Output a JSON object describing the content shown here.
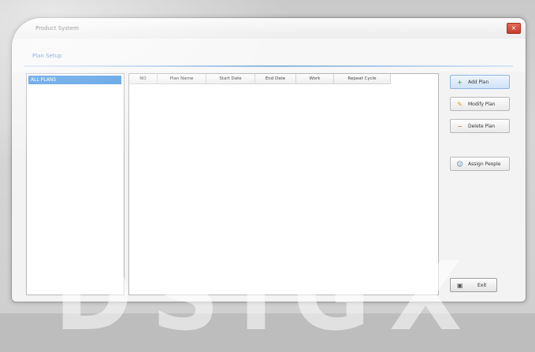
{
  "window": {
    "title": "Product System",
    "close_label": "×"
  },
  "tabs": [
    {
      "label": "Plan Setup"
    }
  ],
  "tree": {
    "selected_item": "ALL PLANS"
  },
  "grid": {
    "columns": [
      "NO",
      "Plan Name",
      "Start Date",
      "End Date",
      "Work",
      "Repeat Cycle"
    ]
  },
  "buttons": {
    "add": "Add Plan",
    "modify": "Modify Plan",
    "delete": "Delete Plan",
    "assign": "Assign People",
    "exit": "Exit"
  },
  "watermark": {
    "text": "DSIGX"
  },
  "colors": {
    "accent": "#3b8fe0",
    "close": "#d9463a"
  }
}
